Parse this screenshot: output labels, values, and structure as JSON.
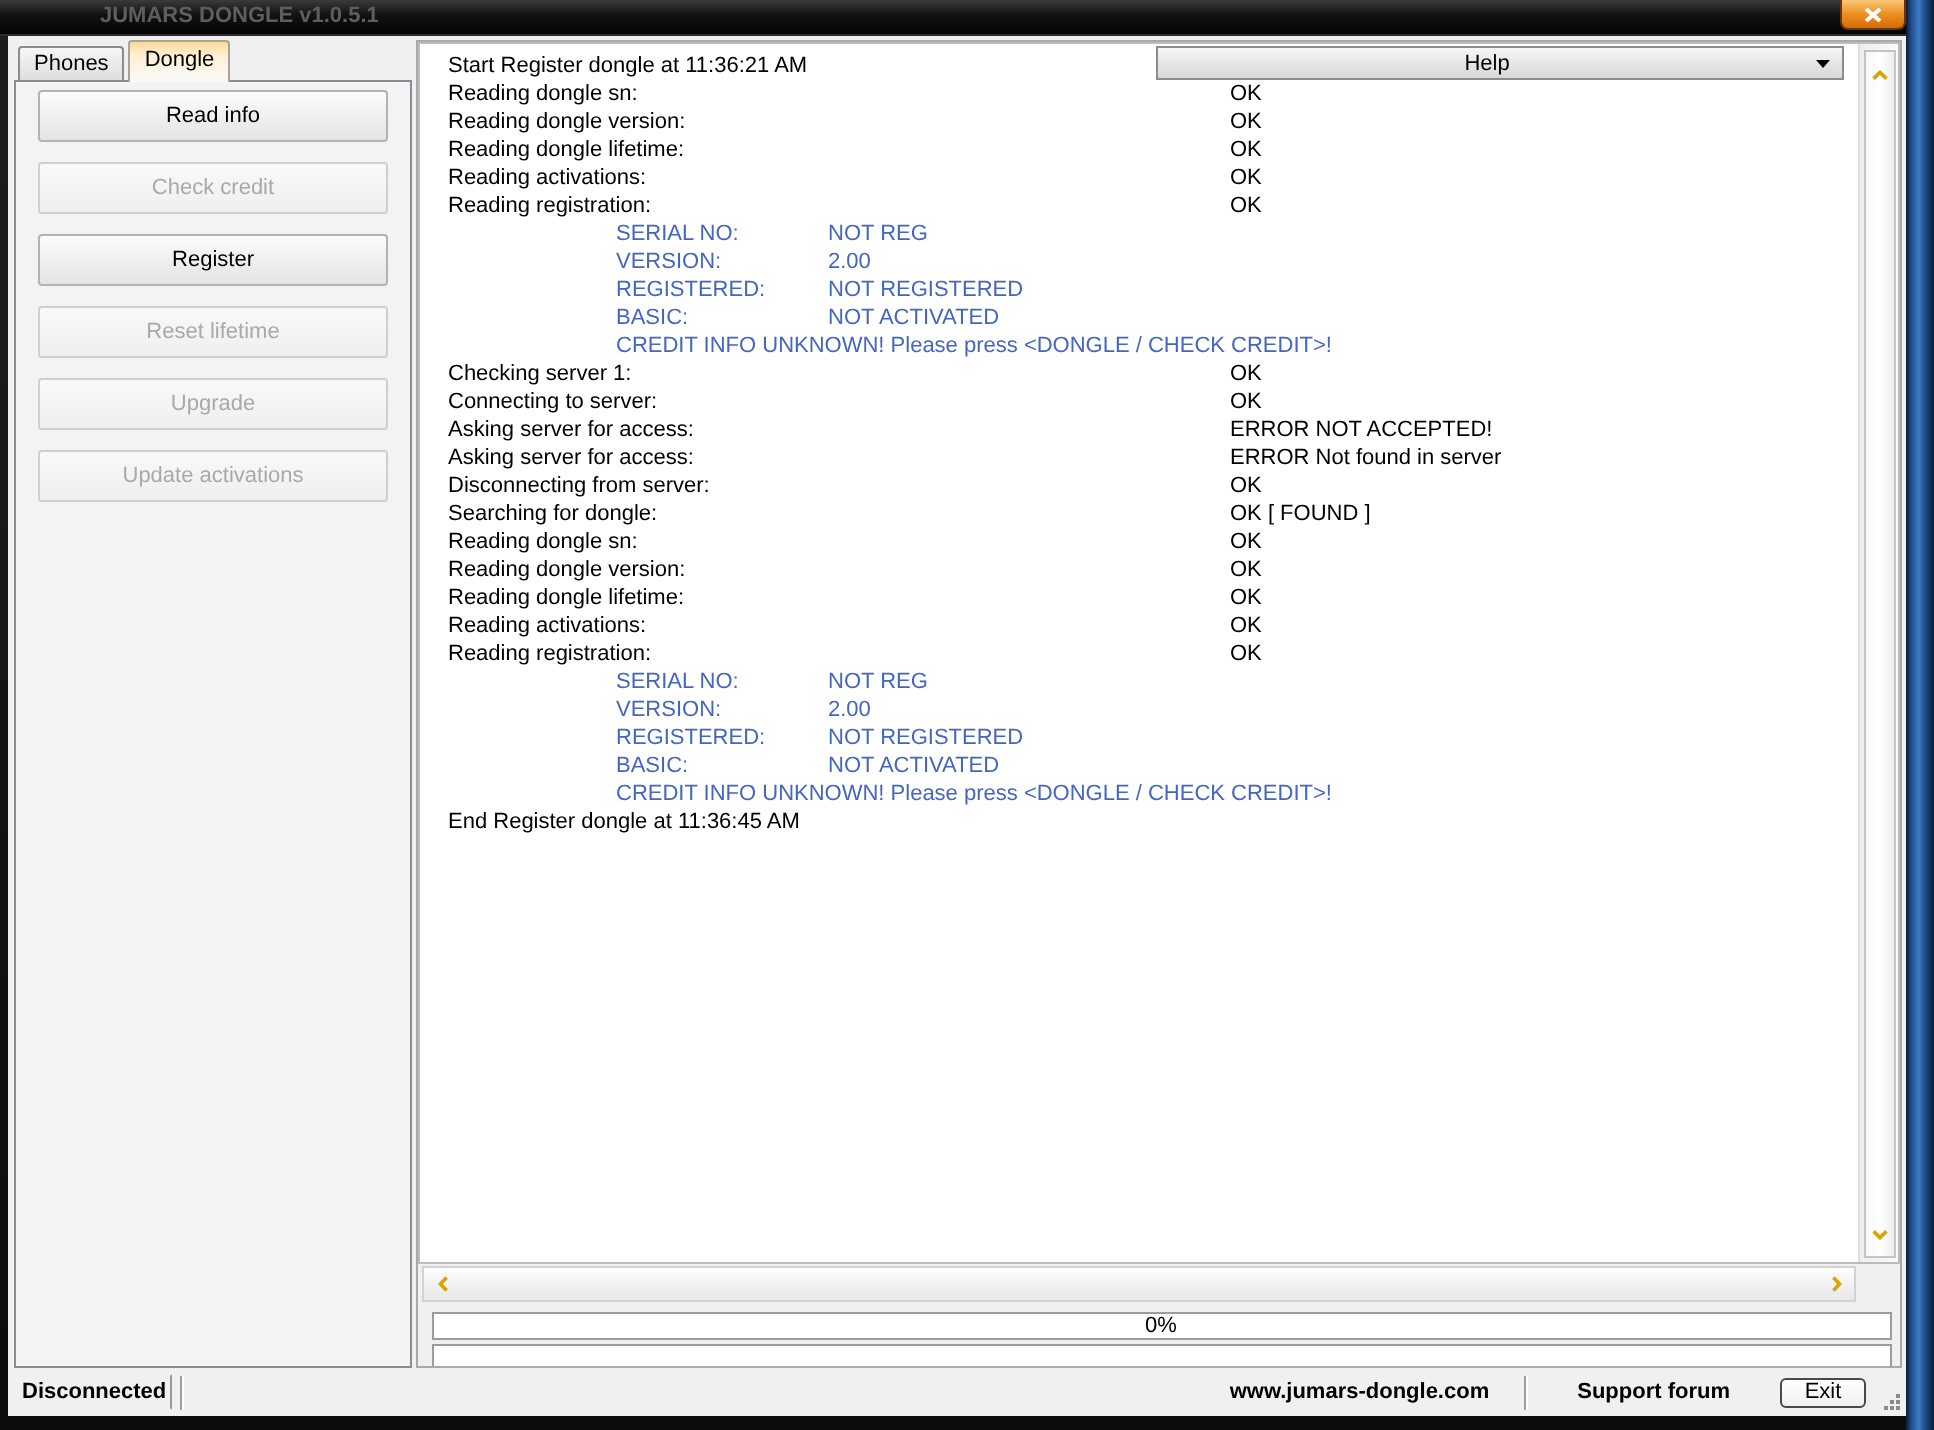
{
  "window": {
    "title": "JUMARS DONGLE v1.0.5.1"
  },
  "tabs": [
    {
      "label": "Phones",
      "selected": false
    },
    {
      "label": "Dongle",
      "selected": true
    }
  ],
  "dongle_actions": [
    {
      "label": "Read info",
      "disabled": false
    },
    {
      "label": "Check credit",
      "disabled": true
    },
    {
      "label": "Register",
      "disabled": false
    },
    {
      "label": "Reset lifetime",
      "disabled": true
    },
    {
      "label": "Upgrade",
      "disabled": true
    },
    {
      "label": "Update activations",
      "disabled": true
    }
  ],
  "help_dropdown": {
    "label": "Help"
  },
  "log": [
    {
      "kind": "line",
      "text": "Start Register dongle at 11:36:21 AM"
    },
    {
      "kind": "line",
      "text": "Reading dongle sn:",
      "result": "OK"
    },
    {
      "kind": "line",
      "text": "Reading dongle version:",
      "result": "OK"
    },
    {
      "kind": "line",
      "text": "Reading dongle lifetime:",
      "result": "OK"
    },
    {
      "kind": "line",
      "text": "Reading activations:",
      "result": "OK"
    },
    {
      "kind": "line",
      "text": "Reading registration:",
      "result": "OK"
    },
    {
      "kind": "field",
      "label": "SERIAL NO:",
      "value": "NOT REG"
    },
    {
      "kind": "field",
      "label": "VERSION:",
      "value": "2.00"
    },
    {
      "kind": "field",
      "label": "REGISTERED:",
      "value": "NOT REGISTERED"
    },
    {
      "kind": "field",
      "label": "BASIC:",
      "value": "NOT ACTIVATED"
    },
    {
      "kind": "note",
      "text": "CREDIT INFO UNKNOWN! Please press <DONGLE / CHECK CREDIT>!"
    },
    {
      "kind": "line",
      "text": "Checking server 1:",
      "result": "OK"
    },
    {
      "kind": "line",
      "text": "Connecting to server:",
      "result": "OK"
    },
    {
      "kind": "line",
      "text": "Asking server for access:",
      "result": "ERROR NOT ACCEPTED!"
    },
    {
      "kind": "line",
      "text": "Asking server for access:",
      "result": "ERROR Not found in server"
    },
    {
      "kind": "line",
      "text": "Disconnecting from server:",
      "result": "OK"
    },
    {
      "kind": "line",
      "text": "Searching for dongle:",
      "result": "OK [ FOUND ]"
    },
    {
      "kind": "line",
      "text": "Reading dongle sn:",
      "result": "OK"
    },
    {
      "kind": "line",
      "text": "Reading dongle version:",
      "result": "OK"
    },
    {
      "kind": "line",
      "text": "Reading dongle lifetime:",
      "result": "OK"
    },
    {
      "kind": "line",
      "text": "Reading activations:",
      "result": "OK"
    },
    {
      "kind": "line",
      "text": "Reading registration:",
      "result": "OK"
    },
    {
      "kind": "field",
      "label": "SERIAL NO:",
      "value": "NOT REG"
    },
    {
      "kind": "field",
      "label": "VERSION:",
      "value": "2.00"
    },
    {
      "kind": "field",
      "label": "REGISTERED:",
      "value": "NOT REGISTERED"
    },
    {
      "kind": "field",
      "label": "BASIC:",
      "value": "NOT ACTIVATED"
    },
    {
      "kind": "note",
      "text": "CREDIT INFO UNKNOWN! Please press <DONGLE / CHECK CREDIT>!"
    },
    {
      "kind": "line",
      "text": "End Register dongle at 11:36:45 AM"
    }
  ],
  "progress_bars": [
    {
      "level": 0,
      "reading": "0%"
    },
    {
      "level": 0
    }
  ],
  "status_bar": {
    "connection": "Disconnected",
    "website": "www.jumars-dongle.com",
    "support_link": "Support forum",
    "exit_button": "Exit"
  }
}
